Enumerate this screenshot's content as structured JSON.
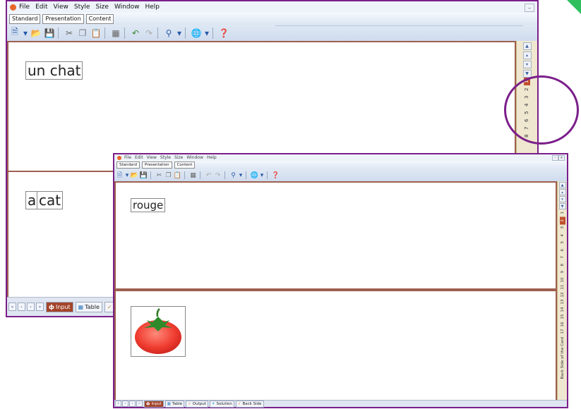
{
  "menu": {
    "items": [
      "File",
      "Edit",
      "View",
      "Style",
      "Size",
      "Window",
      "Help"
    ]
  },
  "ribbon_tabs": [
    "Standard",
    "Presentation",
    "Content"
  ],
  "toolbar_icons": [
    "new-document-icon",
    "dropdown-icon",
    "open-folder-icon",
    "save-icon",
    "cut-icon",
    "copy-icon",
    "paste-icon",
    "preview-icon",
    "undo-icon",
    "redo-icon",
    "search-icon",
    "dropdown-icon",
    "globe-icon",
    "dropdown-icon",
    "help-icon"
  ],
  "window1": {
    "front_text": "un chat",
    "back_text_a": "a",
    "back_text_b": "cat",
    "card_numbers": [
      "1",
      "2",
      "3",
      "4",
      "5",
      "6",
      "7",
      "8"
    ],
    "selected_card": "1",
    "bottom_tabs": [
      "Input",
      "Table",
      "Ou"
    ]
  },
  "window2": {
    "front_text": "rouge",
    "card_numbers": [
      "1",
      "2",
      "3",
      "4",
      "5",
      "6",
      "7",
      "8",
      "9",
      "10",
      "11",
      "12",
      "13",
      "14",
      "15",
      "16",
      "17"
    ],
    "selected_card": "2",
    "back_side_label": "Back Side of the Card",
    "back_image": "tomato",
    "bottom_tabs": [
      "Input",
      "Table",
      "Output",
      "Solution",
      "Back Side"
    ]
  },
  "colors": {
    "frame": "#7b1f8a",
    "pane_border": "#9e5f4f",
    "selected_tab": "#a3442a",
    "sidebar": "#efe7cf",
    "highlight_circle": "#7b1f8a"
  }
}
